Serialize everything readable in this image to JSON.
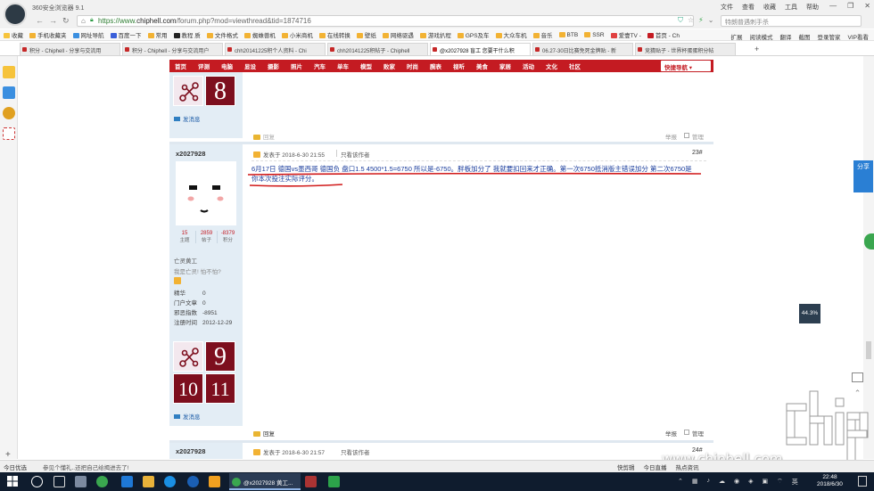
{
  "browser": {
    "app_title": "360安全浏览器 9.1",
    "window_menu": [
      "文件",
      "查看",
      "收藏",
      "工具",
      "帮助"
    ],
    "url_prefix": "https://www.",
    "url_domain": "chiphell.com",
    "url_path": "/forum.php?mod=viewthread&tid=1874716",
    "search_placeholder": "特朗普遇刺手杀",
    "bookmarks": [
      "收藏",
      "手机收藏夹",
      "网址导航",
      "百度一下",
      "常用",
      "教程 质",
      "文件格式",
      "蜘蛛兽机",
      "小米商机",
      "在线转换",
      "壁纸",
      "网络驱遇",
      "游戏扒程",
      "GPS及车",
      "大众车机",
      "音乐",
      "BTB",
      "SSR",
      "爱壹TV -",
      "首页 - Ch"
    ],
    "bookmarks_right": [
      "扩展",
      "阅读模式",
      "翻译",
      "截图",
      "登录管家",
      "VIP看看"
    ],
    "tabs": [
      "积分 - Chiphell - 分享与交流用",
      "积分 - Chiphell - 分享与交流用户",
      "chh20141225积个人资料 - Chi",
      "chh20141225积帖子 - Chiphell",
      "@x2027928 盲工 您要干什么积",
      "06.27-30日比赛免死金牌贴 - 新",
      "竞猜贴子 - 世界杯蛋蛋积分帖"
    ],
    "active_tab_index": 4
  },
  "forum_nav": {
    "items": [
      "首页",
      "评测",
      "电脑",
      "显设",
      "摄影",
      "照片",
      "汽车",
      "单车",
      "模型",
      "败家",
      "时尚",
      "腕表",
      "视听",
      "美食",
      "家居",
      "活动",
      "文化",
      "社区"
    ],
    "quick_nav": "快捷导航"
  },
  "prev_post": {
    "tile_number": "8",
    "send_message": "发消息",
    "reply": "回复",
    "report": "举报",
    "manage": "管理"
  },
  "post": {
    "author": "x2027928",
    "stats": [
      {
        "value": "15",
        "label": "主题"
      },
      {
        "value": "2859",
        "label": "帖子"
      },
      {
        "value": "-8379",
        "label": "积分"
      }
    ],
    "user_title": "亡灵黄工",
    "signature": "我是亡灵! 怕不怕?",
    "info": [
      {
        "label": "精华",
        "value": "0"
      },
      {
        "label": "门户文章",
        "value": "0"
      },
      {
        "label": "邪恶指数",
        "value": "-8951"
      },
      {
        "label": "注册时间",
        "value": "2012-12-29"
      }
    ],
    "medal_tiles": [
      "9",
      "10",
      "11"
    ],
    "send_message": "发消息",
    "posted_at": "发表于 2018-6-30 21:55",
    "only_author": "只看该作者",
    "floor": "23#",
    "body": "6月17日 德国vs墨西哥  德国负 盘口1.5  4500*1.5=6750 所以是-6750。胖板加分了 我就要扣回来才正确。第一次6750抵消版主错误加分 第二次6750是你本次投注实际评分。",
    "reply": "回复",
    "report": "举报",
    "manage": "管理"
  },
  "next_post": {
    "author": "x2027928",
    "posted_at": "发表于 2018-6-30 21:57",
    "only_author": "只看该作者",
    "floor": "24#"
  },
  "side": {
    "share_label": "分享",
    "zoom_badge": "44.3%"
  },
  "watermark": {
    "url": "www.chiphell.com",
    "logo_text": "chiphell"
  },
  "statusbar": {
    "left": [
      "今日优选",
      "参见个懂礼..还把自己给揭进去了!"
    ],
    "right": [
      "快剪辑",
      "今日直播",
      "热点资讯"
    ]
  },
  "taskbar": {
    "active_window": "@x2027928 黄工...",
    "time": "22:48",
    "date": "2018/6/30",
    "ime": "英"
  },
  "colors": {
    "forum_red": "#c41b22",
    "link_blue": "#1a3c9c",
    "author_bg": "#e3edf5"
  }
}
